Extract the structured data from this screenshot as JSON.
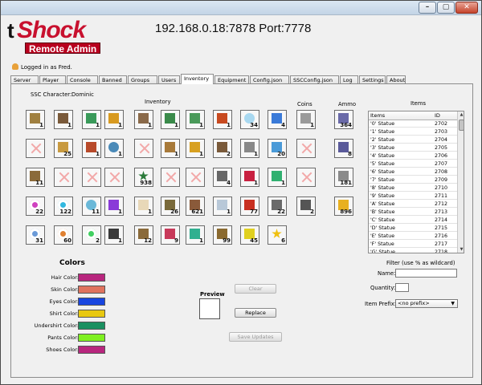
{
  "window": {
    "controls": [
      "–",
      "▢",
      "✕"
    ]
  },
  "header": {
    "logo_t": "t",
    "logo_main": "Shock",
    "logo_sub": "Remote Admin",
    "address": "192.168.0.18:7878   Port:7778",
    "logged_in": "Logged in as Fred."
  },
  "tabs": [
    "Server",
    "Player",
    "Console",
    "Banned",
    "Groups",
    "Users",
    "Inventory",
    "Equipment",
    "Config.json",
    "SSCConfig.json",
    "Log",
    "Settings",
    "About"
  ],
  "inventory": {
    "ssc_label": "SSC Character:",
    "ssc_name": "Dominic",
    "title": "Inventory",
    "rows": [
      [
        {
          "icon": "sword-icon",
          "count": "1"
        },
        {
          "icon": "gun-icon",
          "count": "1"
        },
        {
          "icon": "pickaxe-icon",
          "count": "1"
        },
        {
          "icon": "torch-icon",
          "count": "1"
        },
        {
          "icon": "shotgun-icon",
          "count": "1"
        },
        {
          "icon": "axe-icon",
          "count": "1"
        },
        {
          "icon": "hammer-icon",
          "count": "1"
        },
        {
          "icon": "spellbook-icon",
          "count": "1"
        },
        {
          "icon": "glass-icon",
          "count": "34"
        },
        {
          "icon": "potion-icon",
          "count": "4"
        }
      ],
      [
        {
          "icon": "",
          "count": ""
        },
        {
          "icon": "pet-icon",
          "count": "25"
        },
        {
          "icon": "drill-icon",
          "count": "1"
        },
        {
          "icon": "ring-icon",
          "count": "1"
        },
        {
          "icon": "",
          "count": ""
        },
        {
          "icon": "cross-tool-icon",
          "count": "1"
        },
        {
          "icon": "staff-icon",
          "count": "1"
        },
        {
          "icon": "chair-icon",
          "count": "2"
        },
        {
          "icon": "block-icon",
          "count": "1"
        },
        {
          "icon": "wand-icon",
          "count": "20"
        }
      ],
      [
        {
          "icon": "bar-icon",
          "count": "11"
        },
        {
          "icon": "",
          "count": ""
        },
        {
          "icon": "",
          "count": ""
        },
        {
          "icon": "",
          "count": ""
        },
        {
          "icon": "tree-icon",
          "count": "938"
        },
        {
          "icon": "",
          "count": ""
        },
        {
          "icon": "",
          "count": ""
        },
        {
          "icon": "spike-icon",
          "count": "4"
        },
        {
          "icon": "ruby-icon",
          "count": "1"
        },
        {
          "icon": "emerald-icon",
          "count": "1"
        }
      ],
      [
        {
          "icon": "orb-icon",
          "count": "22"
        },
        {
          "icon": "orb-icon",
          "count": "122"
        },
        {
          "icon": "crystal-icon",
          "count": "11"
        },
        {
          "icon": "moon-icon",
          "count": "1"
        },
        {
          "icon": "scroll-icon",
          "count": "1"
        },
        {
          "icon": "seed-icon",
          "count": "26"
        },
        {
          "icon": "wood-icon",
          "count": "621"
        },
        {
          "icon": "dust-icon",
          "count": "1"
        },
        {
          "icon": "red-block-icon",
          "count": "77"
        },
        {
          "icon": "stone-icon",
          "count": "22"
        }
      ],
      [
        {
          "icon": "orb-icon",
          "count": "31"
        },
        {
          "icon": "orb-icon",
          "count": "60"
        },
        {
          "icon": "orb-icon",
          "count": "2"
        },
        {
          "icon": "cauldron-icon",
          "count": "1"
        },
        {
          "icon": "cake-icon",
          "count": "12"
        },
        {
          "icon": "present-icon",
          "count": "9"
        },
        {
          "icon": "tome-icon",
          "count": "1"
        },
        {
          "icon": "acorn-icon",
          "count": "99"
        },
        {
          "icon": "lemon-icon",
          "count": "45"
        },
        {
          "icon": "star-icon",
          "count": "6"
        }
      ]
    ]
  },
  "coins": {
    "title": "Coins",
    "slots": [
      {
        "icon": "bow-icon",
        "count": "1"
      },
      {
        "icon": "",
        "count": ""
      },
      {
        "icon": "",
        "count": ""
      },
      {
        "icon": "statue-icon",
        "count": "2"
      }
    ]
  },
  "ammo": {
    "title": "Ammo",
    "slots": [
      {
        "icon": "arrow-icon",
        "count": "364"
      },
      {
        "icon": "bolt-icon",
        "count": "8"
      },
      {
        "icon": "shard-icon",
        "count": "181"
      },
      {
        "icon": "bullet-icon",
        "count": "896"
      }
    ]
  },
  "items": {
    "title": "Items",
    "headers": [
      "Items",
      "ID"
    ],
    "rows": [
      {
        "name": "'0' Statue",
        "id": "2702"
      },
      {
        "name": "'1' Statue",
        "id": "2703"
      },
      {
        "name": "'2' Statue",
        "id": "2704"
      },
      {
        "name": "'3' Statue",
        "id": "2705"
      },
      {
        "name": "'4' Statue",
        "id": "2706"
      },
      {
        "name": "'5' Statue",
        "id": "2707"
      },
      {
        "name": "'6' Statue",
        "id": "2708"
      },
      {
        "name": "'7' Statue",
        "id": "2709"
      },
      {
        "name": "'8' Statue",
        "id": "2710"
      },
      {
        "name": "'9' Statue",
        "id": "2711"
      },
      {
        "name": "'A' Statue",
        "id": "2712"
      },
      {
        "name": "'B' Statue",
        "id": "2713"
      },
      {
        "name": "'C' Statue",
        "id": "2714"
      },
      {
        "name": "'D' Statue",
        "id": "2715"
      },
      {
        "name": "'E' Statue",
        "id": "2716"
      },
      {
        "name": "'F' Statue",
        "id": "2717"
      },
      {
        "name": "'G' Statue",
        "id": "2718"
      }
    ]
  },
  "filter": {
    "title": "Filter (use % as wildcard)",
    "name_label": "Name:",
    "name_value": "",
    "quantity_label": "Quantity:",
    "quantity_value": "",
    "prefix_label": "Item Prefix:",
    "prefix_value": "<no prefix>"
  },
  "colors": {
    "title": "Colors",
    "items": [
      {
        "label": "Hair Color:",
        "color": "#b8267e"
      },
      {
        "label": "Skin Color:",
        "color": "#e0735e"
      },
      {
        "label": "Eyes Color:",
        "color": "#1845e0"
      },
      {
        "label": "Shirt Color:",
        "color": "#e8c810"
      },
      {
        "label": "Undershirt Color:",
        "color": "#1a9060"
      },
      {
        "label": "Pants Color:",
        "color": "#7ef020"
      },
      {
        "label": "Shoes Color:",
        "color": "#b8267e"
      }
    ]
  },
  "preview": {
    "label": "Preview"
  },
  "buttons": {
    "clear": "Clear",
    "replace": "Replace",
    "save": "Save Updates"
  }
}
